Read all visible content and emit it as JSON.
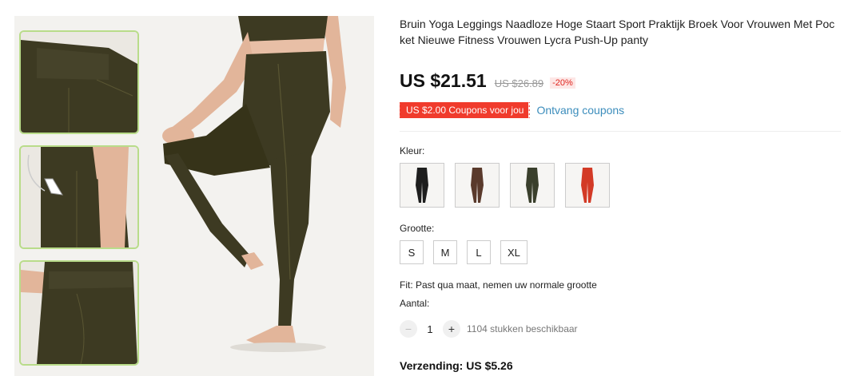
{
  "product": {
    "title": "Bruin Yoga Leggings Naadloze Hoge Staart Sport Praktijk Broek Voor Vrouwen Met Pocket Nieuwe Fitness Vrouwen Lycra Push-Up panty",
    "price": "US $21.51",
    "old_price": "US $26.89",
    "discount": "-20%"
  },
  "coupon": {
    "badge": "US $2.00 Coupons voor jou",
    "link": "Ontvang coupons"
  },
  "color": {
    "label": "Kleur:",
    "options": [
      {
        "name": "black",
        "hex": "#1e1e1e"
      },
      {
        "name": "brown",
        "hex": "#5a3a2c"
      },
      {
        "name": "olive",
        "hex": "#3a3f2c"
      },
      {
        "name": "red",
        "hex": "#d33a26"
      }
    ]
  },
  "size": {
    "label": "Grootte:",
    "options": [
      "S",
      "M",
      "L",
      "XL"
    ]
  },
  "fit": "Fit: Past qua maat, nemen uw normale grootte",
  "quantity": {
    "label": "Aantal:",
    "minus": "−",
    "value": "1",
    "plus": "+",
    "stock": "1104 stukken beschikbaar"
  },
  "shipping": "Verzending: US $5.26",
  "colors": {
    "legging": "#3d3a22",
    "skin": "#e2b59a",
    "thumb_border": "#b9dc8a",
    "discount_red": "#e0261f",
    "coupon_red": "#f03b2c",
    "link_blue": "#3c8dbc"
  }
}
